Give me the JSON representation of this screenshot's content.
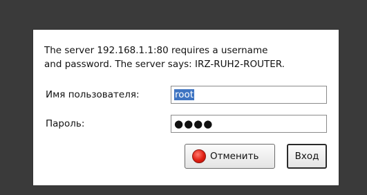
{
  "dialog": {
    "message_line1": "The server 192.168.1.1:80 requires a username",
    "message_line2": "and password. The server says: IRZ-RUH2-ROUTER.",
    "username_label": "Имя пользователя:",
    "username_value": "root",
    "password_label": "Пароль:",
    "password_mask": "●●●●",
    "cancel_label": "Отменить",
    "login_label": "Вход"
  },
  "icons": {
    "cancel": "cancel-icon"
  },
  "colors": {
    "backdrop": "#3a3a3a",
    "selection": "#3e74c2",
    "cancel_icon": "#e01e12"
  }
}
